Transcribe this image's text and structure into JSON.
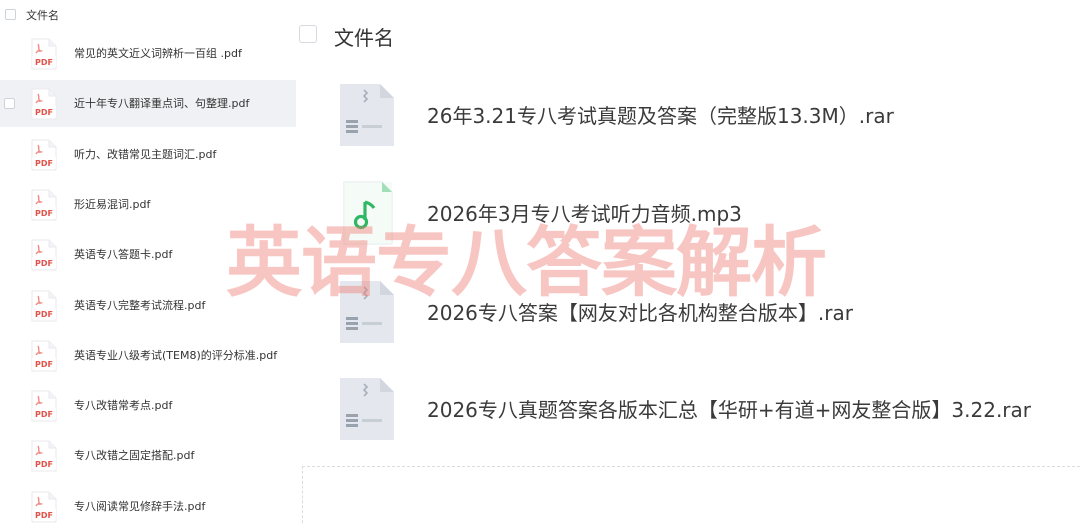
{
  "left_panel": {
    "header_label": "文件名",
    "files": [
      {
        "name": "常见的英文近义词辨析一百组 .pdf",
        "icon": "pdf-icon",
        "icon_text": "PDF"
      },
      {
        "name": "近十年专八翻译重点词、句整理.pdf",
        "icon": "pdf-icon",
        "icon_text": "PDF",
        "selected": true
      },
      {
        "name": "听力、改错常见主题词汇.pdf",
        "icon": "pdf-icon",
        "icon_text": "PDF"
      },
      {
        "name": "形近易混词.pdf",
        "icon": "pdf-icon",
        "icon_text": "PDF"
      },
      {
        "name": "英语专八答题卡.pdf",
        "icon": "pdf-icon",
        "icon_text": "PDF"
      },
      {
        "name": "英语专八完整考试流程.pdf",
        "icon": "pdf-icon",
        "icon_text": "PDF"
      },
      {
        "name": "英语专业八级考试(TEM8)的评分标准.pdf",
        "icon": "pdf-icon",
        "icon_text": "PDF"
      },
      {
        "name": "专八改错常考点.pdf",
        "icon": "pdf-icon",
        "icon_text": "PDF"
      },
      {
        "name": "专八改错之固定搭配.pdf",
        "icon": "pdf-icon",
        "icon_text": "PDF"
      },
      {
        "name": "专八阅读常见修辞手法.pdf",
        "icon": "pdf-icon",
        "icon_text": "PDF"
      }
    ]
  },
  "right_panel": {
    "header_label": "文件名",
    "files": [
      {
        "name": "26年3.21专八考试真题及答案（完整版13.3M）.rar",
        "icon": "archive-icon"
      },
      {
        "name": "2026年3月专八考试听力音频.mp3",
        "icon": "music-file-icon"
      },
      {
        "name": "2026专八答案【网友对比各机构整合版本】.rar",
        "icon": "archive-icon"
      },
      {
        "name": "2026专八真题答案各版本汇总【华研+有道+网友整合版】3.22.rar",
        "icon": "archive-icon"
      }
    ]
  },
  "watermark": "英语专八答案解析",
  "colors": {
    "pdf_red": "#e2534b",
    "music_green": "#2fb864",
    "archive_gray": "#dfe3ea",
    "watermark": "#ee786e",
    "selected_row": "#f0f1f4"
  }
}
